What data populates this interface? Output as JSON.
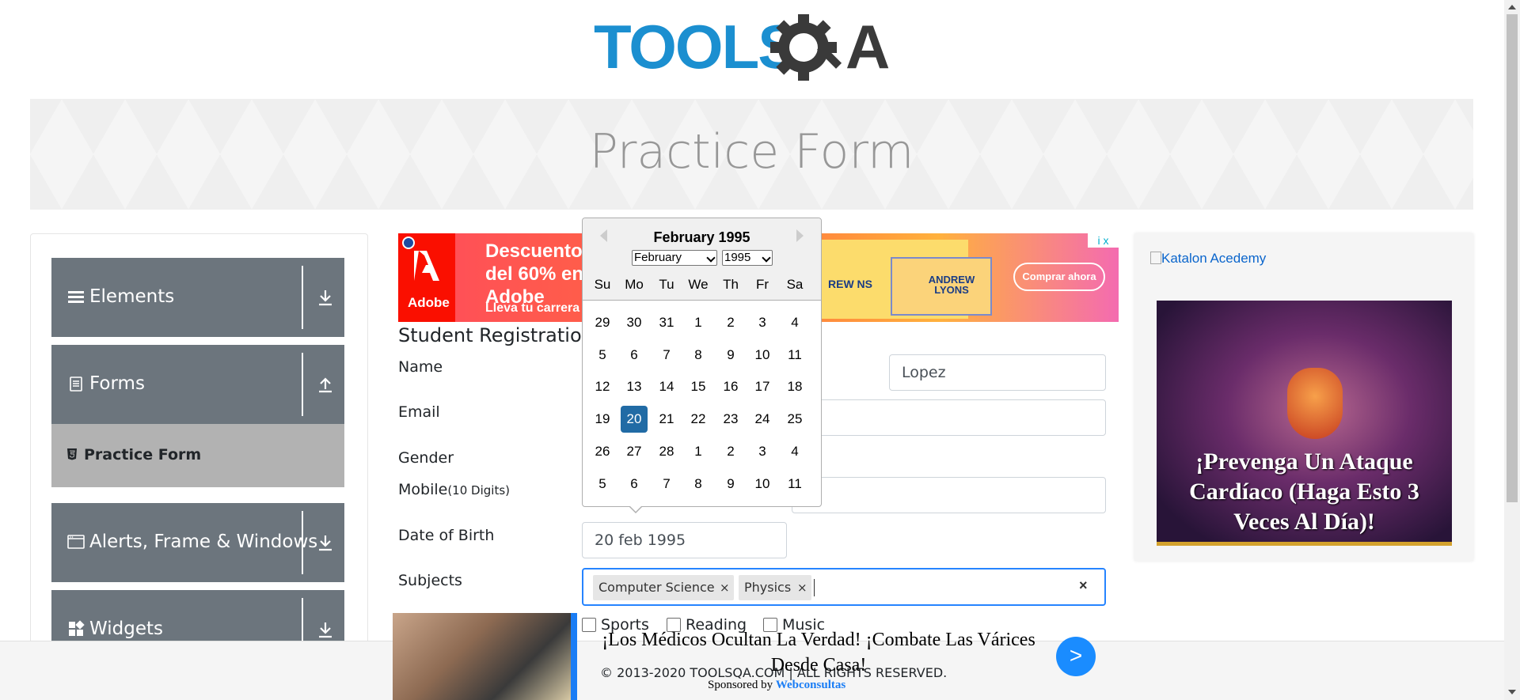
{
  "header": {
    "logo_text_left": "TOOLS",
    "logo_text_right": "A",
    "banner_title": "Practice Form"
  },
  "sidebar": {
    "groups": [
      {
        "label": "Elements",
        "icon": "hamburger-icon",
        "arrow": "download-icon"
      },
      {
        "label": "Forms",
        "icon": "document-icon",
        "arrow": "upload-icon"
      },
      {
        "label": "Alerts, Frame & Windows",
        "icon": "window-icon",
        "arrow": "download-icon"
      },
      {
        "label": "Widgets",
        "icon": "widgets-icon",
        "arrow": "download-icon"
      }
    ],
    "active_item": {
      "label": "Practice Form",
      "icon": "html5-icon"
    }
  },
  "ad_top": {
    "brand": "Adobe",
    "headline": "Descuento del 60% en Adobe Creative Cloud para estudiantes",
    "subline": "Lleva tu carrera",
    "card1": "REW NS",
    "card2_name": "ANDREW LYONS",
    "cta": "Comprar ahora",
    "adchoices": "i x"
  },
  "form": {
    "title": "Student Registration Form",
    "labels": {
      "name": "Name",
      "email": "Email",
      "gender": "Gender",
      "mobile": "Mobile",
      "mobile_hint": "(10 Digits)",
      "dob": "Date of Birth",
      "subjects": "Subjects"
    },
    "last_name_value": "Lopez",
    "dob_value": "20 feb 1995",
    "subjects": [
      "Computer Science",
      "Physics"
    ],
    "chip_remove": "×",
    "clear_all": "×",
    "hobbies": [
      "Sports",
      "Reading",
      "Music"
    ]
  },
  "datepicker": {
    "title": "February 1995",
    "month_select": "February",
    "year_select": "1995",
    "day_names": [
      "Su",
      "Mo",
      "Tu",
      "We",
      "Th",
      "Fr",
      "Sa"
    ],
    "weeks": [
      [
        "29",
        "30",
        "31",
        "1",
        "2",
        "3",
        "4"
      ],
      [
        "5",
        "6",
        "7",
        "8",
        "9",
        "10",
        "11"
      ],
      [
        "12",
        "13",
        "14",
        "15",
        "16",
        "17",
        "18"
      ],
      [
        "19",
        "20",
        "21",
        "22",
        "23",
        "24",
        "25"
      ],
      [
        "26",
        "27",
        "28",
        "1",
        "2",
        "3",
        "4"
      ],
      [
        "5",
        "6",
        "7",
        "8",
        "9",
        "10",
        "11"
      ]
    ],
    "selected_day": "20"
  },
  "ad_right": {
    "broken_image_alt": "Katalon Acedemy",
    "headline": "¡Prevenga Un Ataque Cardíaco (Haga Esto 3 Veces Al Día)!"
  },
  "ad_bottom": {
    "headline": "¡Los Médicos Ocultan La Verdad! ¡Combate Las Várices Desde Casa!",
    "sponsored_prefix": "Sponsored by",
    "sponsor": "Webconsultas",
    "go": ">"
  },
  "footer": {
    "text": "© 2013-2020 TOOLSQA.COM | ALL RIGHTS RESERVED."
  },
  "colors": {
    "sidebar_group": "#6c757d",
    "sidebar_active": "#b2b2b2",
    "focus_border": "#2684ff",
    "selected_day": "#216ba5",
    "logo_blue": "#1b8fd0",
    "logo_dark": "#3a3a3a"
  }
}
